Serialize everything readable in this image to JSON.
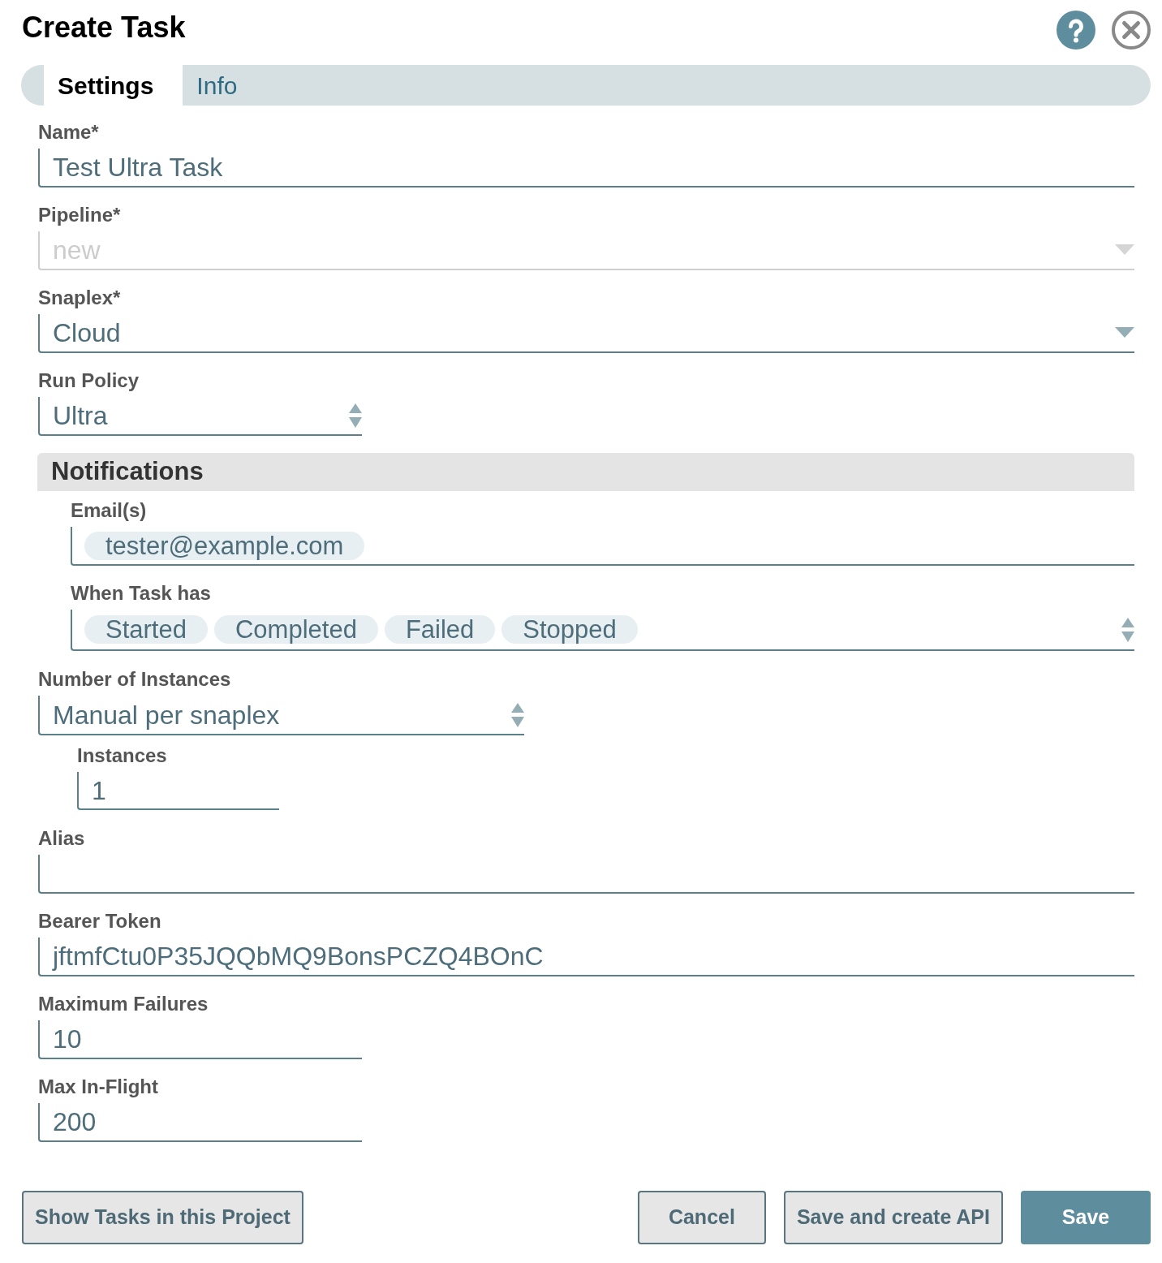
{
  "title": "Create Task",
  "tabs": [
    {
      "label": "Settings",
      "selected": true
    },
    {
      "label": "Info",
      "selected": false
    }
  ],
  "name": {
    "label": "Name*",
    "value": "Test Ultra Task"
  },
  "pipeline": {
    "label": "Pipeline*",
    "value": "new",
    "disabled": true
  },
  "snaplex": {
    "label": "Snaplex*",
    "value": "Cloud"
  },
  "run_policy": {
    "label": "Run Policy",
    "value": "Ultra"
  },
  "notifications": {
    "title": "Notifications",
    "emails": {
      "label": "Email(s)",
      "chips": [
        "tester@example.com"
      ]
    },
    "when_task_has": {
      "label": "When Task has",
      "chips": [
        "Started",
        "Completed",
        "Failed",
        "Stopped"
      ]
    }
  },
  "number_of_instances": {
    "label": "Number of Instances",
    "value": "Manual per snaplex"
  },
  "instances": {
    "label": "Instances",
    "value": "1"
  },
  "alias": {
    "label": "Alias"
  },
  "bearer_token": {
    "label": "Bearer Token",
    "value": "jftmfCtu0P35JQQbMQ9BonsPCZQ4BOnC"
  },
  "maximum_failures": {
    "label": "Maximum Failures",
    "value": "10"
  },
  "max_in_flight": {
    "label": "Max In-Flight",
    "value": "200"
  },
  "footer": {
    "left_buttons": [
      {
        "label": "Show Tasks in this Project",
        "kind": "secondary"
      }
    ],
    "right_buttons": [
      {
        "label": "Cancel",
        "kind": "secondary"
      },
      {
        "label": "Save and create API",
        "kind": "secondary"
      },
      {
        "label": "Save",
        "kind": "primary"
      }
    ]
  }
}
